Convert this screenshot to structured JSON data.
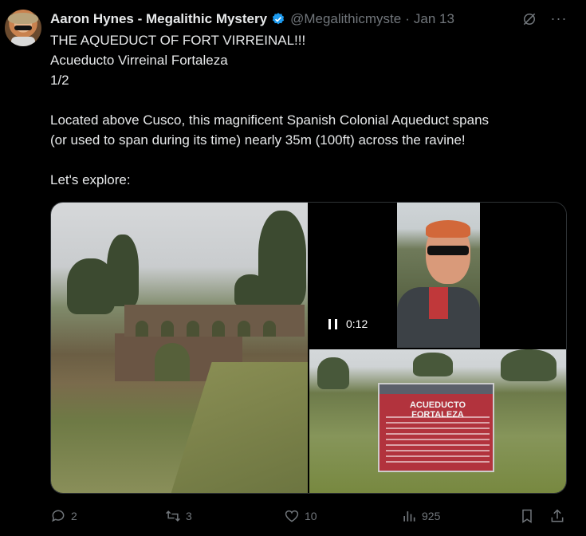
{
  "tweet": {
    "author_name": "Aaron Hynes - Megalithic Mystery",
    "handle": "@Megalithicmyste",
    "separator": "·",
    "date": "Jan 13",
    "text_lines": [
      "THE AQUEDUCT OF FORT VIRREINAL!!!",
      "Acueducto Virreinal Fortaleza",
      "1/2",
      "",
      "Located above Cusco, this magnificent Spanish Colonial Aqueduct spans",
      "(or used to span during its time) nearly 35m (100ft) across the ravine!",
      "",
      "Let's explore:"
    ]
  },
  "media": {
    "video_time": "0:12",
    "sign_title": "ACUEDUCTO FORTALEZA"
  },
  "actions": {
    "replies": "2",
    "reposts": "3",
    "likes": "10",
    "views": "925"
  },
  "colors": {
    "background": "#000000",
    "text": "#e7e9ea",
    "muted": "#71767b",
    "verified": "#1d9bf0"
  },
  "icons": [
    "verified-badge-icon",
    "grok-icon",
    "more-icon",
    "reply-icon",
    "repost-icon",
    "like-icon",
    "views-icon",
    "bookmark-icon",
    "share-icon",
    "pause-icon"
  ]
}
